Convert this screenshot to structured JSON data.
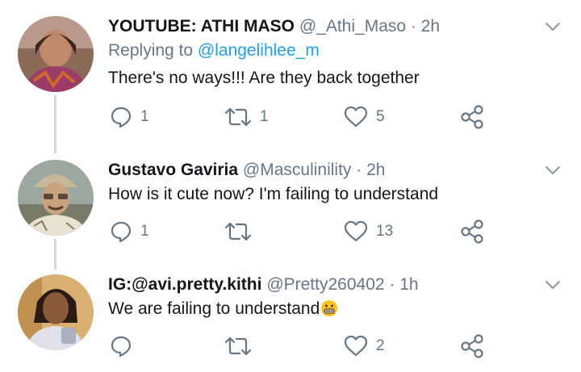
{
  "tweets": [
    {
      "name": "YOUTUBE: ATHI MASO",
      "handle": "@_Athi_Maso",
      "dot": "·",
      "time": "2h",
      "replying_prefix": "Replying to",
      "replying_handle": "@langelihlee_m",
      "text": "There's no ways!!! Are they back together",
      "replies": "1",
      "retweets": "1",
      "likes": "5"
    },
    {
      "name": "Gustavo Gaviria",
      "handle": "@Masculinility",
      "dot": "·",
      "time": "2h",
      "text": "How is it cute now? I'm failing to understand",
      "replies": "1",
      "retweets": "",
      "likes": "13"
    },
    {
      "name": "IG:@avi.pretty.kithi",
      "handle": "@Pretty260402",
      "dot": "·",
      "time": "1h",
      "text": "We are failing to understand",
      "emoji": "grimacing-face-emoji",
      "replies": "",
      "retweets": "",
      "likes": "2"
    }
  ],
  "colors": {
    "text": "#14171a",
    "secondary": "#657786",
    "link": "#1da1f2",
    "thread_line": "#cfd9de",
    "icon": "#657786"
  },
  "icons": [
    "reply-icon",
    "retweet-icon",
    "like-icon",
    "share-icon",
    "chevron-down-icon"
  ]
}
